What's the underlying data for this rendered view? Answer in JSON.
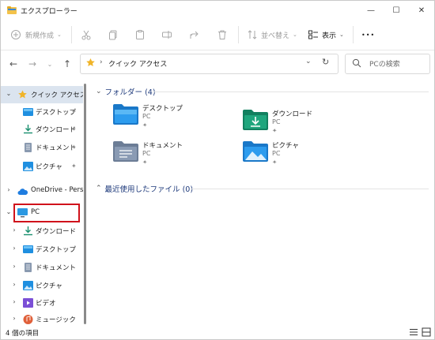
{
  "window": {
    "title": "エクスプローラー",
    "controls": {
      "minimize": "—",
      "maximize": "☐",
      "close": "✕"
    }
  },
  "toolbar": {
    "new_label": "新規作成",
    "sort_label": "並べ替え",
    "view_label": "表示",
    "more_label": "•••"
  },
  "address": {
    "path": "クイック アクセス",
    "search_placeholder": "PCの検索"
  },
  "sidebar": {
    "items": [
      {
        "label": "クイック アクセス",
        "icon": "star-icon"
      },
      {
        "label": "デスクトップ",
        "icon": "desktop-folder-icon",
        "pinned": true
      },
      {
        "label": "ダウンロード",
        "icon": "download-folder-icon",
        "pinned": true
      },
      {
        "label": "ドキュメント",
        "icon": "documents-folder-icon",
        "pinned": true
      },
      {
        "label": "ピクチャ",
        "icon": "pictures-folder-icon",
        "pinned": true
      },
      {
        "label": "OneDrive - Perso",
        "icon": "onedrive-cloud-icon"
      },
      {
        "label": "PC",
        "icon": "pc-monitor-icon"
      },
      {
        "label": "ダウンロード",
        "icon": "download-folder-icon"
      },
      {
        "label": "デスクトップ",
        "icon": "desktop-folder-icon"
      },
      {
        "label": "ドキュメント",
        "icon": "documents-folder-icon"
      },
      {
        "label": "ピクチャ",
        "icon": "pictures-folder-icon"
      },
      {
        "label": "ビデオ",
        "icon": "videos-folder-icon"
      },
      {
        "label": "ミュージック",
        "icon": "music-folder-icon"
      }
    ],
    "pin_glyph": "✦"
  },
  "main": {
    "folders_header": "フォルダー (4)",
    "recent_header": "最近使用したファイル (0)",
    "folders": [
      {
        "name": "デスクトップ",
        "location": "PC",
        "icon": "desktop-folder-icon"
      },
      {
        "name": "ダウンロード",
        "location": "PC",
        "icon": "download-folder-icon"
      },
      {
        "name": "ドキュメント",
        "location": "PC",
        "icon": "documents-folder-icon"
      },
      {
        "name": "ピクチャ",
        "location": "PC",
        "icon": "pictures-folder-icon"
      }
    ],
    "pin_glyph": "✦"
  },
  "status": {
    "item_count": "4 個の項目"
  },
  "colors": {
    "selection_bg": "#dbe4ef",
    "highlight_border": "#d0121b",
    "group_header_text": "#1e3a7b",
    "folder_blue": "#1f8fe0",
    "folder_teal": "#1a8f6e"
  }
}
